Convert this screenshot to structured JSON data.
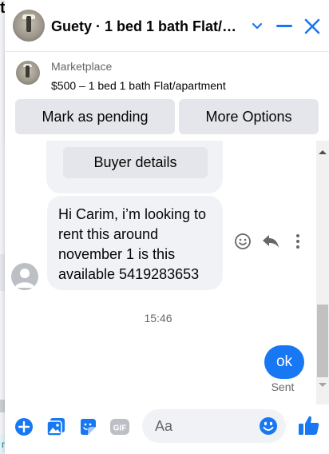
{
  "background": {
    "edge_letter": "t",
    "edge_label": "ner"
  },
  "header": {
    "title": "Guety · 1 bed 1 bath Flat/apartment",
    "accent_color": "#1877f2"
  },
  "marketplace": {
    "label": "Marketplace",
    "listing": "$500 – 1 bed 1 bath Flat/apartment",
    "mark_pending_label": "Mark as pending",
    "more_options_label": "More Options"
  },
  "conversation": {
    "buyer_details_label": "Buyer details",
    "incoming_message": "Hi Carim, i’m looking to rent this around november 1 is this available 5419283653",
    "timestamp": "15:46",
    "outgoing_message": "ok",
    "status": "Sent"
  },
  "composer": {
    "placeholder": "Aa",
    "gif_label": "GIF",
    "icons": [
      "plus-icon",
      "photo-icon",
      "sticker-icon",
      "gif-icon",
      "emoji-icon",
      "thumbs-up-icon"
    ]
  },
  "message_actions": [
    "react-emoji-icon",
    "reply-icon",
    "more-icon"
  ]
}
